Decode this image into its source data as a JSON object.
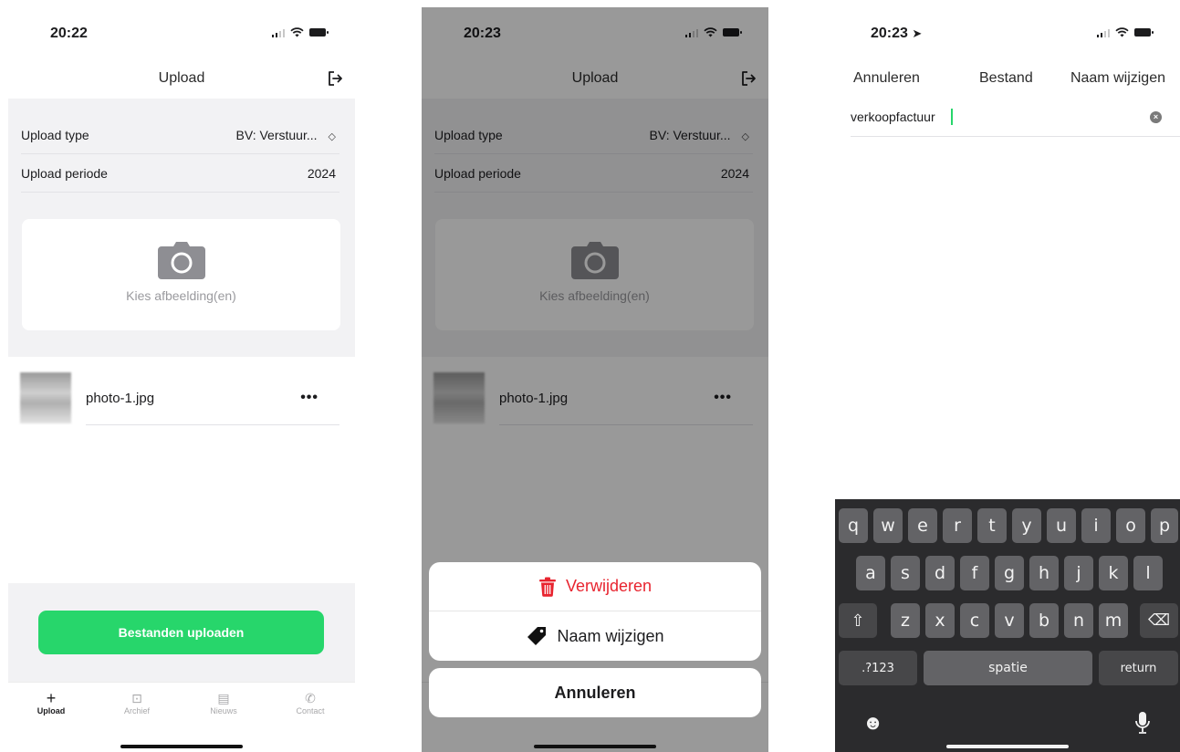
{
  "screens": [
    {
      "status_time": "20:22",
      "nav_title": "Upload",
      "form": {
        "upload_type_label": "Upload type",
        "upload_type_value": "BV: Verstuur...",
        "upload_period_label": "Upload periode",
        "upload_period_value": "2024"
      },
      "picker_label": "Kies afbeelding(en)",
      "file_name": "photo-1.jpg",
      "more_label": "•••",
      "upload_button": "Bestanden uploaden",
      "tabs": [
        {
          "icon": "+",
          "label": "Upload"
        },
        {
          "icon": "⊡",
          "label": "Archief"
        },
        {
          "icon": "▤",
          "label": "Nieuws"
        },
        {
          "icon": "✆",
          "label": "Contact"
        }
      ]
    },
    {
      "status_time": "20:23",
      "nav_title": "Upload",
      "form": {
        "upload_type_label": "Upload type",
        "upload_type_value": "BV: Verstuur...",
        "upload_period_label": "Upload periode",
        "upload_period_value": "2024"
      },
      "picker_label": "Kies afbeelding(en)",
      "file_name": "photo-1.jpg",
      "more_label": "•••",
      "action_sheet": {
        "delete": "Verwijderen",
        "rename": "Naam wijzigen",
        "cancel": "Annuleren"
      }
    },
    {
      "status_time": "20:23",
      "nav": {
        "left": "Annuleren",
        "title": "Bestand",
        "right": "Naam wijzigen"
      },
      "name_value": "verkoopfactuur",
      "keyboard": {
        "row1": [
          "q",
          "w",
          "e",
          "r",
          "t",
          "y",
          "u",
          "i",
          "o",
          "p"
        ],
        "row2": [
          "a",
          "s",
          "d",
          "f",
          "g",
          "h",
          "j",
          "k",
          "l"
        ],
        "row3": [
          "z",
          "x",
          "c",
          "v",
          "b",
          "n",
          "m"
        ],
        "numbers_key": ".?123",
        "space_key": "spatie",
        "return_key": "return"
      }
    }
  ],
  "colors": {
    "accent_green": "#27d66b",
    "destructive_red": "#e8242f",
    "background_grey": "#f2f2f4",
    "keyboard_bg": "#2b2b2d"
  }
}
